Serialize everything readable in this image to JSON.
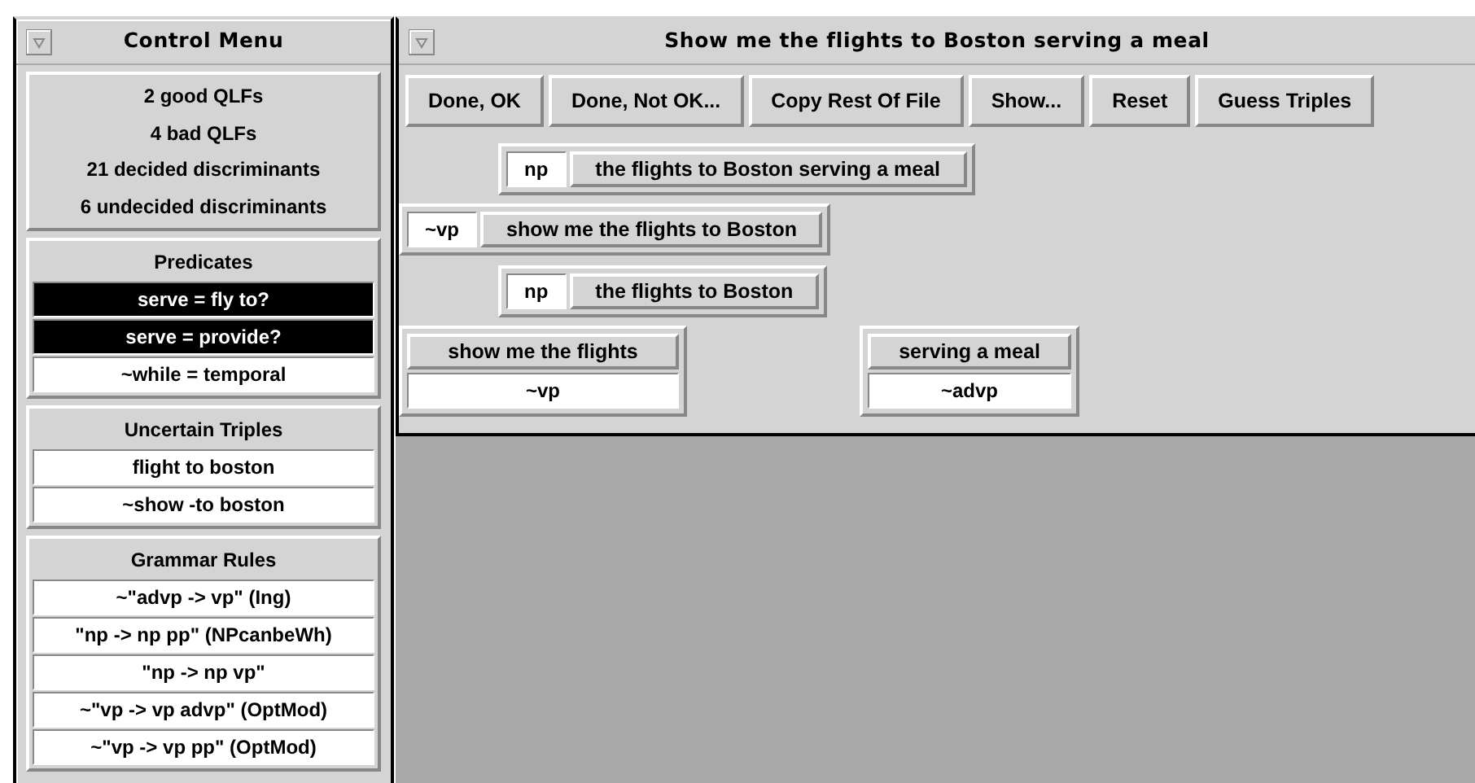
{
  "control_menu": {
    "title": "Control Menu",
    "stats": [
      "2 good QLFs",
      "4 bad QLFs",
      "21 decided discriminants",
      "6 undecided discriminants"
    ],
    "predicates": {
      "title": "Predicates",
      "items": [
        {
          "label": "serve = fly to?",
          "selected": true
        },
        {
          "label": "serve = provide?",
          "selected": true
        },
        {
          "label": "~while = temporal",
          "selected": false
        }
      ]
    },
    "uncertain_triples": {
      "title": "Uncertain Triples",
      "items": [
        {
          "label": "flight to boston",
          "selected": false
        },
        {
          "label": "~show -to boston",
          "selected": false
        }
      ]
    },
    "grammar_rules": {
      "title": "Grammar Rules",
      "items": [
        {
          "label": "~\"advp -> vp\" (Ing)",
          "selected": false
        },
        {
          "label": "\"np -> np pp\" (NPcanbeWh)",
          "selected": false
        },
        {
          "label": "\"np -> np vp\"",
          "selected": false
        },
        {
          "label": "~\"vp -> vp advp\" (OptMod)",
          "selected": false
        },
        {
          "label": "~\"vp -> vp pp\" (OptMod)",
          "selected": false
        }
      ]
    }
  },
  "parse_window": {
    "title": "Show me the flights to Boston serving a meal",
    "buttons": [
      "Done, OK",
      "Done, Not OK...",
      "Copy Rest Of File",
      "Show...",
      "Reset",
      "Guess Triples"
    ],
    "parse_nodes": [
      {
        "kind": "row",
        "category": "np",
        "text": "the flights to Boston serving a meal"
      },
      {
        "kind": "row",
        "category": "~vp",
        "text": "show me the flights to Boston"
      },
      {
        "kind": "row",
        "category": "np",
        "text": "the flights to Boston"
      },
      {
        "kind": "stack",
        "category": "~vp",
        "text": "show me the flights"
      },
      {
        "kind": "stack",
        "category": "~advp",
        "text": "serving a meal"
      }
    ]
  }
}
